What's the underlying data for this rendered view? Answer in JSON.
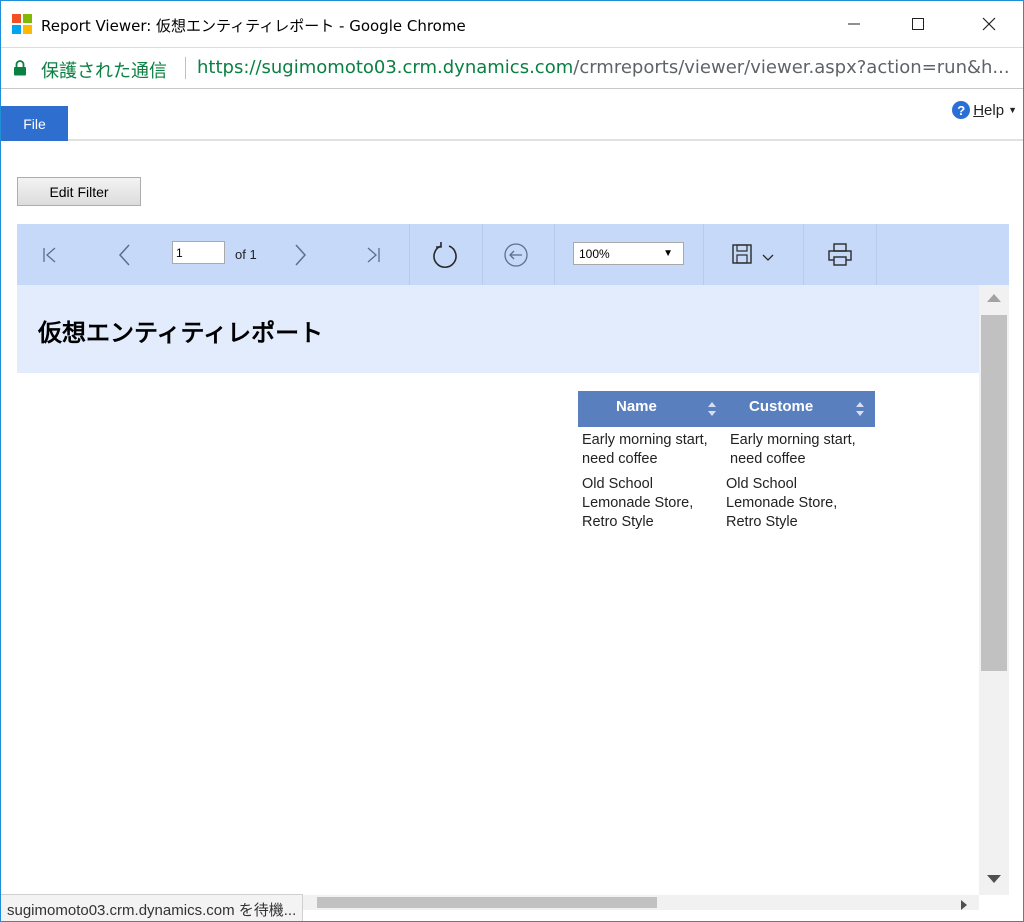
{
  "window": {
    "title": "Report Viewer: 仮想エンティティレポート - Google Chrome",
    "minimize_glyph": "—",
    "maximize_glyph": "☐",
    "close_glyph": "✕"
  },
  "address": {
    "secure_label": "保護された通信",
    "url_origin": "https://sugimomoto03.crm.dynamics.com",
    "url_path": "/crmreports/viewer/viewer.aspx?action=run&h..."
  },
  "ribbon": {
    "file_tab": "File",
    "help_label_first": "H",
    "help_label_rest": "elp"
  },
  "filter": {
    "edit_filter_label": "Edit Filter"
  },
  "toolbar": {
    "current_page": "1",
    "page_of": "of 1",
    "zoom": "100%"
  },
  "report": {
    "title": "仮想エンティティレポート",
    "columns": [
      "Name",
      "Custome"
    ],
    "rows": [
      [
        "Early morning start, need coffee",
        "Early morning start, need coffee"
      ],
      [
        "Old School Lemonade Store, Retro Style",
        "Old School Lemonade Store, Retro Style"
      ]
    ]
  },
  "status_bar": {
    "text": "sugimomoto03.crm.dynamics.com を待機..."
  },
  "colors": {
    "ms_red": "#f25022",
    "ms_green": "#7fba00",
    "ms_blue": "#00a4ef",
    "ms_yellow": "#ffb900",
    "secure_green": "#0b8043",
    "file_tab_blue": "#2e6ecf",
    "toolbar_bg": "#c6d9f8",
    "header_bg": "#e2ecfd",
    "grid_header": "#597fbf"
  }
}
